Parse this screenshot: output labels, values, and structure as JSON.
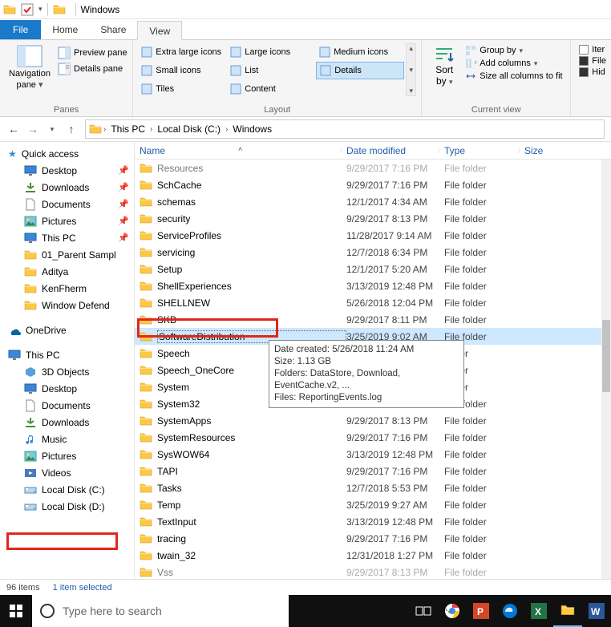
{
  "titlebar": {
    "title": "Windows"
  },
  "tabs": {
    "file": "File",
    "home": "Home",
    "share": "Share",
    "view": "View"
  },
  "ribbon": {
    "panes": {
      "navigation": "Navigation",
      "pane": "pane",
      "preview": "Preview pane",
      "details": "Details pane",
      "group": "Panes"
    },
    "layout": {
      "items": [
        "Extra large icons",
        "Large icons",
        "Medium icons",
        "Small icons",
        "List",
        "Details",
        "Tiles",
        "Content"
      ],
      "group": "Layout"
    },
    "currentview": {
      "sortby": "Sort",
      "by": "by",
      "groupby": "Group by",
      "addcols": "Add columns",
      "sizeall": "Size all columns to fit",
      "group": "Current view"
    },
    "showhide": {
      "itemcb": "Iter",
      "fileext": "File",
      "hidden": "Hid"
    }
  },
  "breadcrumb": {
    "thispc": "This PC",
    "localc": "Local Disk (C:)",
    "windows": "Windows"
  },
  "columns": {
    "name": "Name",
    "date": "Date modified",
    "type": "Type",
    "size": "Size"
  },
  "sidebar": {
    "quick": "Quick access",
    "desktop": "Desktop",
    "downloads": "Downloads",
    "documents": "Documents",
    "pictures": "Pictures",
    "thispc": "This PC",
    "parent": "01_Parent Sampl",
    "aditya": "Aditya",
    "kenfherm": "KenFherm",
    "windef": "Window Defend",
    "onedrive": "OneDrive",
    "thispc2": "This PC",
    "obj3d": "3D Objects",
    "desktop2": "Desktop",
    "documents2": "Documents",
    "downloads2": "Downloads",
    "music": "Music",
    "pictures2": "Pictures",
    "videos": "Videos",
    "localc": "Local Disk (C:)",
    "locald": "Local Disk (D:)"
  },
  "rows": [
    {
      "name": "Resources",
      "date": "9/29/2017 7:16 PM",
      "type": "File folder",
      "dim": true
    },
    {
      "name": "SchCache",
      "date": "9/29/2017 7:16 PM",
      "type": "File folder"
    },
    {
      "name": "schemas",
      "date": "12/1/2017 4:34 AM",
      "type": "File folder"
    },
    {
      "name": "security",
      "date": "9/29/2017 8:13 PM",
      "type": "File folder"
    },
    {
      "name": "ServiceProfiles",
      "date": "11/28/2017 9:14 AM",
      "type": "File folder"
    },
    {
      "name": "servicing",
      "date": "12/7/2018 6:34 PM",
      "type": "File folder"
    },
    {
      "name": "Setup",
      "date": "12/1/2017 5:20 AM",
      "type": "File folder"
    },
    {
      "name": "ShellExperiences",
      "date": "3/13/2019 12:48 PM",
      "type": "File folder"
    },
    {
      "name": "SHELLNEW",
      "date": "5/26/2018 12:04 PM",
      "type": "File folder"
    },
    {
      "name": "SKB",
      "date": "9/29/2017 8:11 PM",
      "type": "File folder"
    },
    {
      "name": "SoftwareDistribution",
      "date": "3/25/2019 9:02 AM",
      "type": "File folder",
      "sel": true
    },
    {
      "name": "Speech",
      "date": "",
      "type": "folder"
    },
    {
      "name": "Speech_OneCore",
      "date": "",
      "type": "folder"
    },
    {
      "name": "System",
      "date": "",
      "type": "folder"
    },
    {
      "name": "System32",
      "date": "3/25/2019 8:59 AM",
      "type": "File folder"
    },
    {
      "name": "SystemApps",
      "date": "9/29/2017 8:13 PM",
      "type": "File folder"
    },
    {
      "name": "SystemResources",
      "date": "9/29/2017 7:16 PM",
      "type": "File folder"
    },
    {
      "name": "SysWOW64",
      "date": "3/13/2019 12:48 PM",
      "type": "File folder"
    },
    {
      "name": "TAPI",
      "date": "9/29/2017 7:16 PM",
      "type": "File folder"
    },
    {
      "name": "Tasks",
      "date": "12/7/2018 5:53 PM",
      "type": "File folder"
    },
    {
      "name": "Temp",
      "date": "3/25/2019 9:27 AM",
      "type": "File folder"
    },
    {
      "name": "TextInput",
      "date": "3/13/2019 12:48 PM",
      "type": "File folder"
    },
    {
      "name": "tracing",
      "date": "9/29/2017 7:16 PM",
      "type": "File folder"
    },
    {
      "name": "twain_32",
      "date": "12/31/2018 1:27 PM",
      "type": "File folder"
    },
    {
      "name": "Vss",
      "date": "9/29/2017 8:13 PM",
      "type": "File folder",
      "dim": true
    }
  ],
  "tooltip": {
    "l1": "Date created: 5/26/2018 11:24 AM",
    "l2": "Size: 1.13 GB",
    "l3": "Folders: DataStore, Download, EventCache.v2, ...",
    "l4": "Files: ReportingEvents.log"
  },
  "status": {
    "items": "96 items",
    "selected": "1 item selected"
  },
  "taskbar": {
    "search": "Type here to search"
  }
}
